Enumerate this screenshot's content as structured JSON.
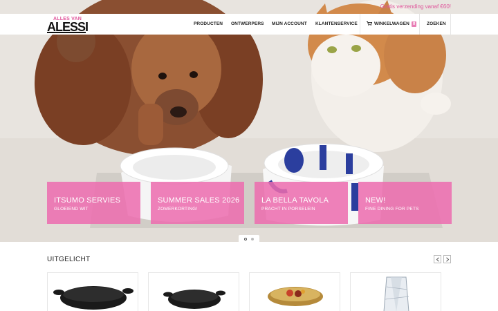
{
  "promo": {
    "text": "Gratis verzending vanaf €60!"
  },
  "brand": {
    "small": "ALLES VAN",
    "big": "ALESSI"
  },
  "nav": {
    "items": [
      "PRODUCTEN",
      "ONTWERPERS",
      "MIJN ACCOUNT",
      "KLANTENSERVICE"
    ],
    "cart_label": "WINKELWAGEN",
    "cart_count": "0",
    "search_label": "ZOEKEN"
  },
  "hero": {
    "tiles": [
      {
        "title": "ITSUMO SERVIES",
        "subtitle": "GLOEIEND WIT"
      },
      {
        "title": "SUMMER SALES 2026",
        "subtitle": "ZOMERKORTING!"
      },
      {
        "title": "LA BELLA TAVOLA",
        "subtitle": "PRACHT IN PORSELEIN"
      },
      {
        "title": "NEW!",
        "subtitle": "FINE DINING FOR PETS"
      }
    ],
    "active_slide": 1,
    "slide_count": 2
  },
  "featured": {
    "title": "UITGELICHT",
    "products": [
      {
        "icon": "black-oval-dish-large"
      },
      {
        "icon": "black-oval-dish-small"
      },
      {
        "icon": "gold-bowl-with-fruit"
      },
      {
        "icon": "crystal-vase"
      }
    ]
  },
  "colors": {
    "accent": "#ec6caf",
    "promo_text": "#e0559b"
  }
}
